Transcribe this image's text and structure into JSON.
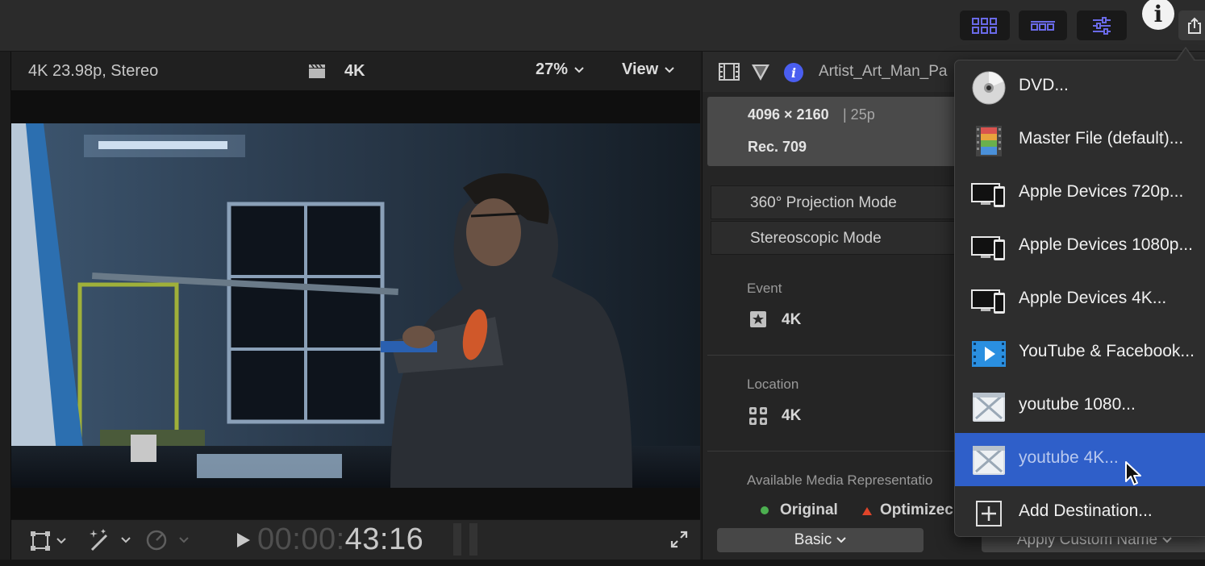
{
  "toolbar": {
    "buttons": [
      {
        "name": "browser-grid-icon",
        "color": "#6a6ae8"
      },
      {
        "name": "timeline-filmstrip-icon",
        "color": "#6a6ae8"
      },
      {
        "name": "inspector-sliders-icon",
        "color": "#6a6ae8"
      }
    ],
    "info_glyph": "i",
    "share_icon": "share-icon"
  },
  "viewer": {
    "format": "4K 23.98p, Stereo",
    "clip_name": "4K",
    "zoom": "27%",
    "view_menu": "View",
    "timecode_dim": "00:00:",
    "timecode_bright": "43:16"
  },
  "inspector": {
    "file_name": "Artist_Art_Man_Pa",
    "resolution": "4096 × 2160",
    "frame_rate": "| 25p",
    "color_space": "Rec. 709",
    "projection_mode": "360° Projection Mode",
    "stereo_mode": "Stereoscopic Mode",
    "event_label": "Event",
    "event_value": "4K",
    "location_label": "Location",
    "location_value": "4K",
    "media_label": "Available Media Representatio",
    "media_original": "Original",
    "media_optimized": "Optimizec",
    "basic_button": "Basic",
    "apply_button": "Apply Custom Name"
  },
  "share_menu": {
    "items": [
      {
        "label": "DVD...",
        "icon": "dvd-disc-icon",
        "selected": false
      },
      {
        "label": "Master File (default)...",
        "icon": "master-file-icon",
        "selected": false
      },
      {
        "label": "Apple Devices 720p...",
        "icon": "apple-devices-icon",
        "selected": false
      },
      {
        "label": "Apple Devices 1080p...",
        "icon": "apple-devices-icon",
        "selected": false
      },
      {
        "label": "Apple Devices 4K...",
        "icon": "apple-devices-icon",
        "selected": false
      },
      {
        "label": "YouTube & Facebook...",
        "icon": "youtube-facebook-icon",
        "selected": false
      },
      {
        "label": "youtube 1080...",
        "icon": "compressor-icon",
        "selected": false
      },
      {
        "label": "youtube 4K...",
        "icon": "compressor-icon",
        "selected": true
      },
      {
        "label": "Add Destination...",
        "icon": "add-destination-icon",
        "selected": false
      }
    ],
    "selected_color": "#2f5fc9"
  }
}
